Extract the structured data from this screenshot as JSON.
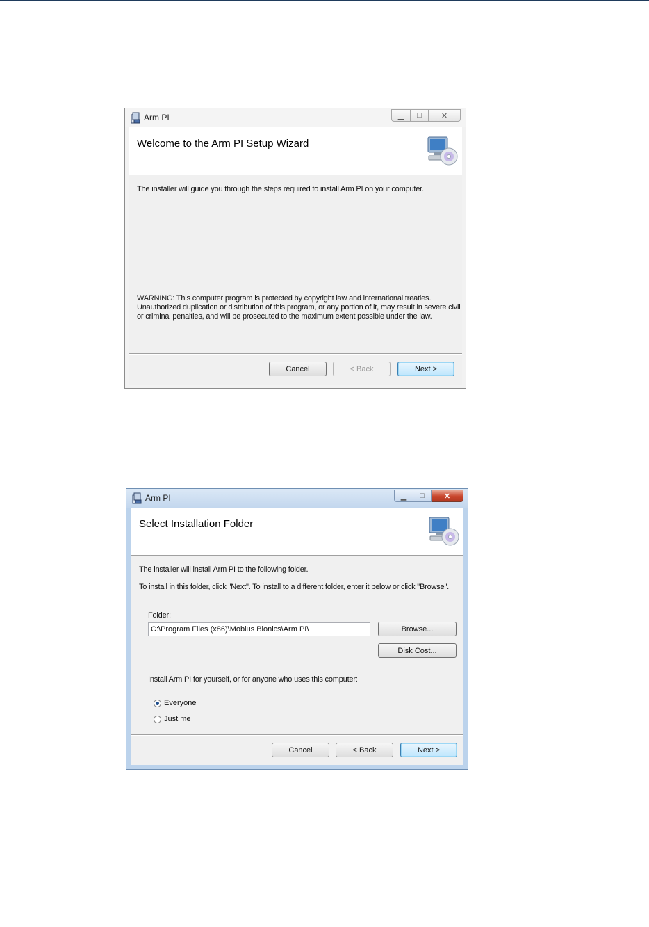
{
  "dialogs": [
    {
      "title": "Arm PI",
      "heading": "Welcome to the Arm PI Setup Wizard",
      "intro": "The installer will guide you through the steps required to install Arm PI on your computer.",
      "warning_lines": [
        "WARNING: This computer program is protected by copyright law and international treaties.",
        "Unauthorized duplication or distribution of this program, or any portion of it, may result in severe civil",
        "or criminal penalties, and will be prosecuted to the maximum extent possible under the law."
      ],
      "buttons": {
        "cancel": "Cancel",
        "back": "< Back",
        "next": "Next >"
      },
      "back_enabled": false
    },
    {
      "title": "Arm PI",
      "heading": "Select Installation Folder",
      "line1": "The installer will install Arm PI to the following folder.",
      "line2": "To install in this folder, click \"Next\". To install to a different folder, enter it below or click \"Browse\".",
      "folder_label": "Folder:",
      "folder_value": "C:\\Program Files (x86)\\Mobius Bionics\\Arm PI\\",
      "browse": "Browse...",
      "disk_cost": "Disk Cost...",
      "install_for": "Install Arm PI for yourself, or for anyone who uses this computer:",
      "radio_everyone": "Everyone",
      "radio_just_me": "Just me",
      "selected": "Everyone",
      "buttons": {
        "cancel": "Cancel",
        "back": "< Back",
        "next": "Next >"
      },
      "back_enabled": true
    }
  ],
  "icons": {
    "app": "installer-icon",
    "banner": "computer-cd-icon",
    "minimize": "minimize-icon",
    "maximize": "maximize-icon",
    "close": "close-icon"
  },
  "colors": {
    "page_rule": "#1f3b5c",
    "close_active": "#c8442b"
  }
}
